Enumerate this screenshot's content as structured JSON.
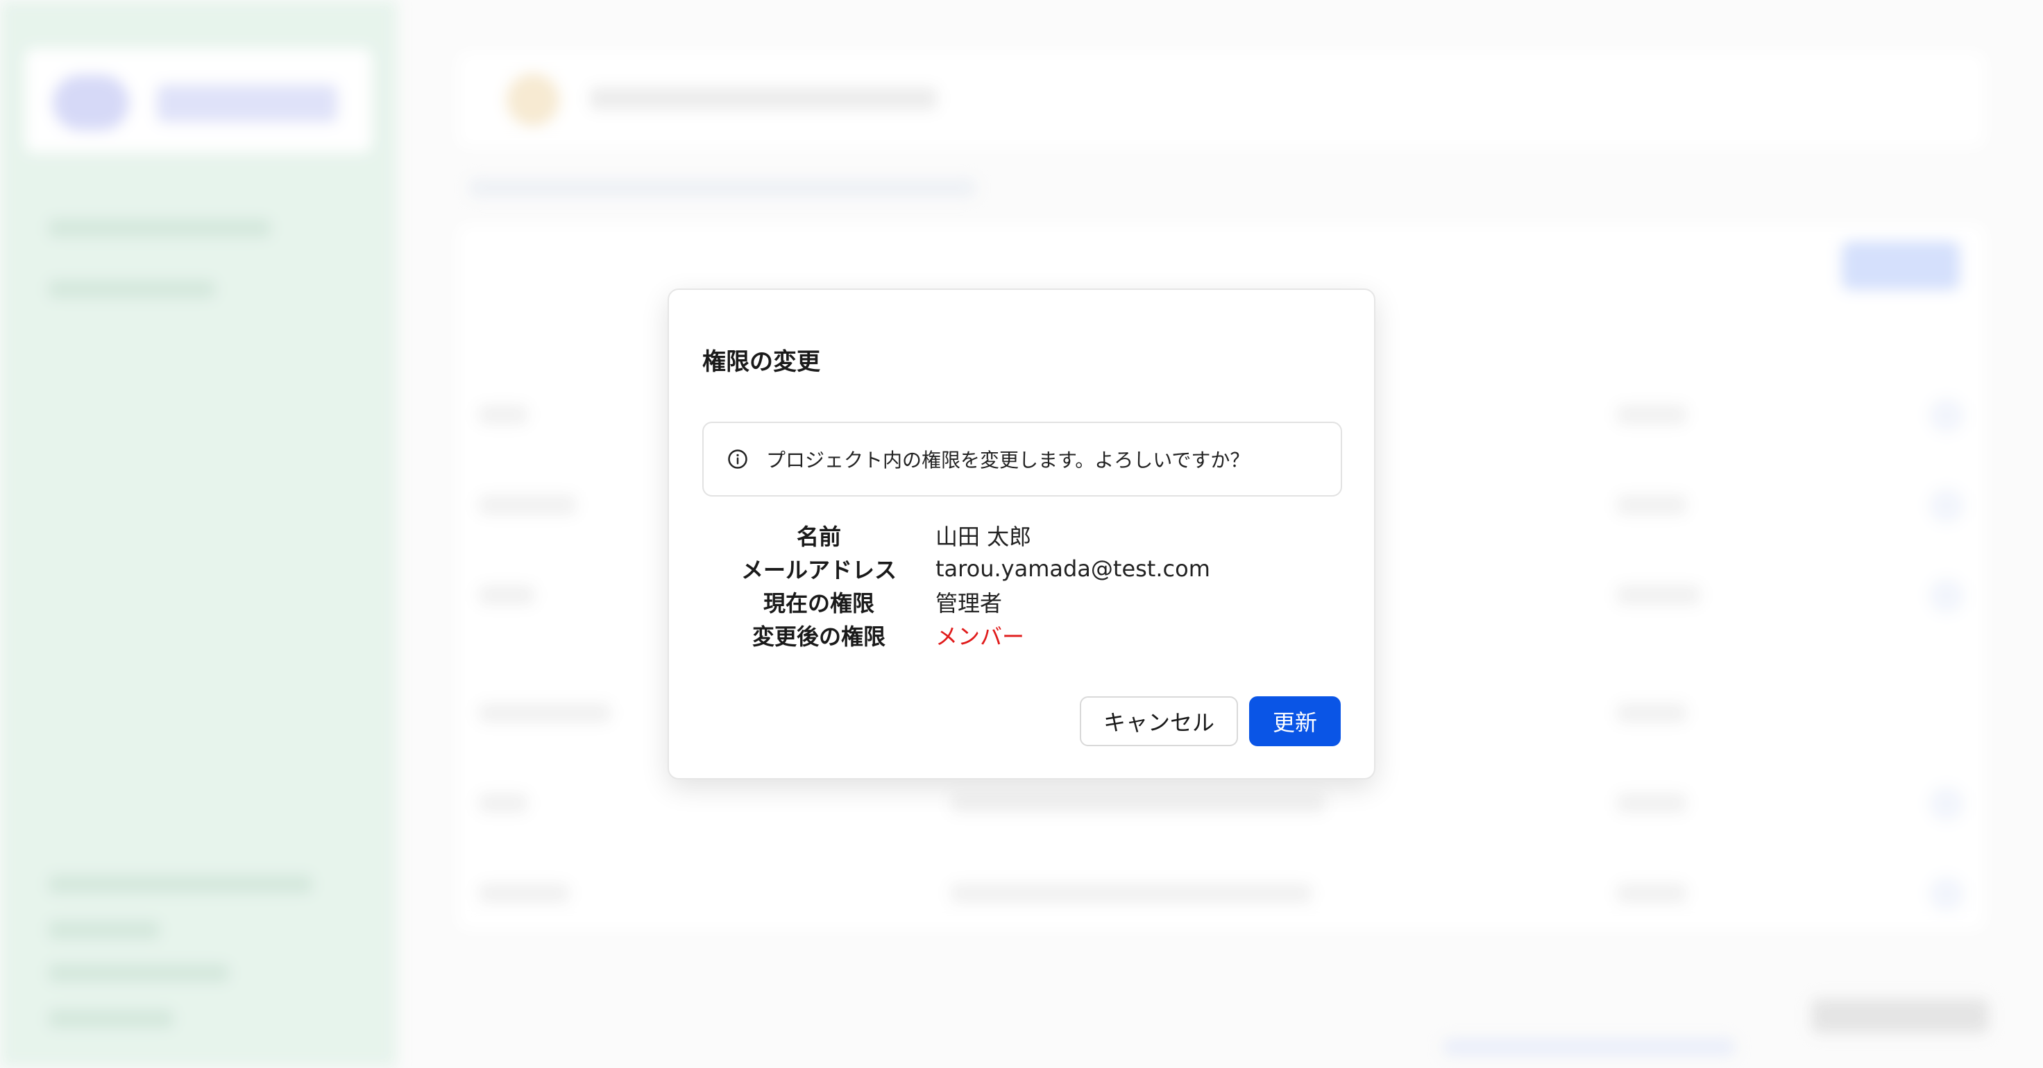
{
  "dialog": {
    "title": "権限の変更",
    "notice": {
      "icon": "info-icon",
      "text": "プロジェクト内の権限を変更します。よろしいですか？"
    },
    "details": [
      {
        "label": "名前",
        "value": "山田 太郎"
      },
      {
        "label": "メールアドレス",
        "value": "tarou.yamada@test.com"
      },
      {
        "label": "現在の権限",
        "value": "管理者"
      },
      {
        "label": "変更後の権限",
        "value": "メンバー"
      }
    ],
    "buttons": {
      "cancel": "キャンセル",
      "update": "更新"
    }
  },
  "colors": {
    "primary": "#0a55e6",
    "highlight": "#e01a1a",
    "sidebar": "#dff0e6"
  }
}
